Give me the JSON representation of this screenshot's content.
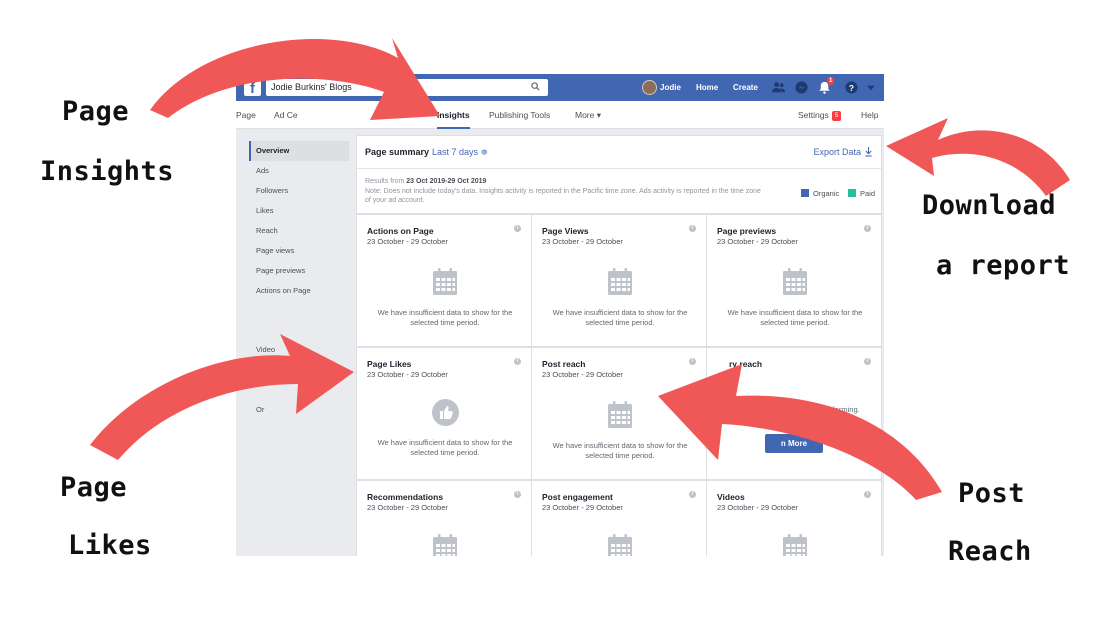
{
  "annotations": {
    "page_insights": [
      "Page",
      "Insights"
    ],
    "download_report": [
      "Download",
      "a report"
    ],
    "page_likes": [
      "Page",
      "Likes"
    ],
    "post_reach": [
      "Post",
      "Reach"
    ],
    "arrow_color": "#f05757"
  },
  "topbar": {
    "logo": "f",
    "search_value": "Jodie Burkins' Blogs",
    "user_name": "Jodie",
    "home": "Home",
    "create": "Create",
    "notification_count": "1",
    "brand_color": "#4267b2"
  },
  "page_tabs": {
    "page": "Page",
    "ad_centre": "Ad Ce",
    "insights": "Insights",
    "publishing_tools": "Publishing Tools",
    "more": "More ▾",
    "settings": "Settings",
    "settings_badge": "5",
    "help": "Help"
  },
  "sidebar": {
    "items": [
      "Overview",
      "Ads",
      "Followers",
      "Likes",
      "Reach",
      "Page views",
      "Page previews",
      "Actions on Page",
      "Video",
      "Or"
    ]
  },
  "summary": {
    "title": "Page summary",
    "period": "Last 7 days ≑",
    "export": "Export Data",
    "results_prefix": "Results from ",
    "results_range": "23 Oct 2019-29 Oct 2019",
    "note": "Note: Does not include today's data. Insights activity is reported in the Pacific time zone. Ads activity is reported in the time zone of your ad account.",
    "legend": [
      {
        "label": "Organic",
        "color": "#4267b2"
      },
      {
        "label": "Paid",
        "color": "#23bfa3"
      }
    ]
  },
  "cards": [
    {
      "title": "Actions on Page",
      "date": "23 October - 29 October",
      "message": "We have insufficient data to show for the selected time period."
    },
    {
      "title": "Page Views",
      "date": "23 October - 29 October",
      "message": "We have insufficient data to show for the selected time period."
    },
    {
      "title": "Page previews",
      "date": "23 October - 29 October",
      "message": "We have insufficient data to show for the selected time period."
    },
    {
      "title": "Page Likes",
      "date": "23 October - 29 October",
      "message": "We have insufficient data to show for the selected time period."
    },
    {
      "title": "Post reach",
      "date": "23 October - 29 October",
      "message": "We have insufficient data to show for the selected time period."
    },
    {
      "title": "ry reach",
      "message": "stats on how your Page's s performing.",
      "button": "n More"
    },
    {
      "title": "Recommendations",
      "date": "23 October - 29 October"
    },
    {
      "title": "Post engagement",
      "date": "23 October - 29 October"
    },
    {
      "title": "Videos",
      "date": "23 October - 29 October"
    }
  ]
}
